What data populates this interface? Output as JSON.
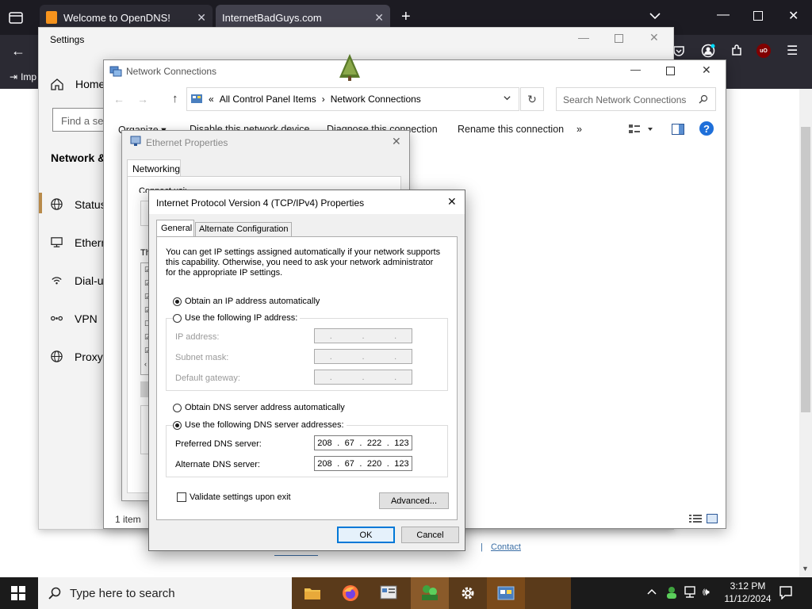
{
  "browser": {
    "tab1_title": "Welcome to OpenDNS!",
    "tab2_title": "InternetBadGuys.com",
    "bookmark_label": "Imp"
  },
  "settings": {
    "title": "Settings",
    "home_label": "Home",
    "search_placeholder": "Find a setting",
    "section_heading": "Network & Internet",
    "nav": [
      "Status",
      "Ethernet",
      "Dial-up",
      "VPN",
      "Proxy"
    ]
  },
  "network_connections": {
    "title": "Network Connections",
    "breadcrumb_prefix": "«",
    "breadcrumb": [
      "All Control Panel Items",
      "Network Connections"
    ],
    "search_placeholder": "Search Network Connections",
    "commands": [
      "Organize ▾",
      "Disable this network device",
      "Diagnose this connection",
      "Rename this connection",
      "»"
    ],
    "status_bar": "1 item"
  },
  "ethernet_properties": {
    "title": "Ethernet Properties",
    "tab": "Networking",
    "connect_using_label": "Connect using:",
    "items_label": "This connection uses the following items:"
  },
  "ipv4": {
    "title": "Internet Protocol Version 4 (TCP/IPv4) Properties",
    "tabs": [
      "General",
      "Alternate Configuration"
    ],
    "description": "You can get IP settings assigned automatically if your network supports this capability. Otherwise, you need to ask your network administrator for the appropriate IP settings.",
    "obtain_ip_auto": "Obtain an IP address automatically",
    "use_following_ip": "Use the following IP address:",
    "ip_address_label": "IP address:",
    "subnet_mask_label": "Subnet mask:",
    "default_gateway_label": "Default gateway:",
    "obtain_dns_auto": "Obtain DNS server address automatically",
    "use_following_dns": "Use the following DNS server addresses:",
    "preferred_dns_label": "Preferred DNS server:",
    "preferred_dns": [
      "208",
      "67",
      "222",
      "123"
    ],
    "alternate_dns_label": "Alternate DNS server:",
    "alternate_dns": [
      "208",
      "67",
      "220",
      "123"
    ],
    "validate_label": "Validate settings upon exit",
    "advanced_button": "Advanced...",
    "ok_button": "OK",
    "cancel_button": "Cancel"
  },
  "webpage": {
    "footer_link": "Contact"
  },
  "taskbar": {
    "search_placeholder": "Type here to search",
    "time": "3:12 PM",
    "date": "11/12/2024"
  }
}
